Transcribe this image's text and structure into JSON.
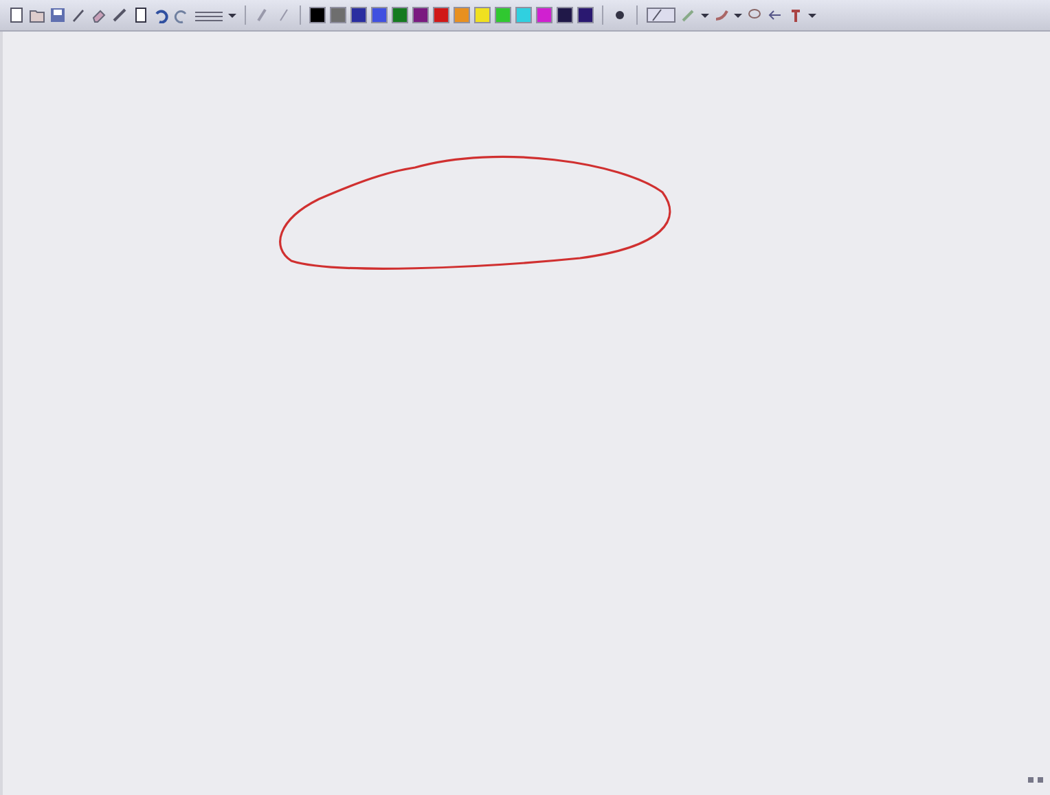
{
  "toolbar": {
    "palette": [
      {
        "color": "#000000"
      },
      {
        "color": "#6e6e6e"
      },
      {
        "color": "#2a2ea0"
      },
      {
        "color": "#4050e0"
      },
      {
        "color": "#157a20"
      },
      {
        "color": "#7a1a80"
      },
      {
        "color": "#d01818"
      },
      {
        "color": "#e89020"
      },
      {
        "color": "#f0e020"
      },
      {
        "color": "#30c830"
      },
      {
        "color": "#30d0e0"
      },
      {
        "color": "#d020d0"
      },
      {
        "color": "#201848"
      },
      {
        "color": "#2a1870"
      }
    ]
  }
}
